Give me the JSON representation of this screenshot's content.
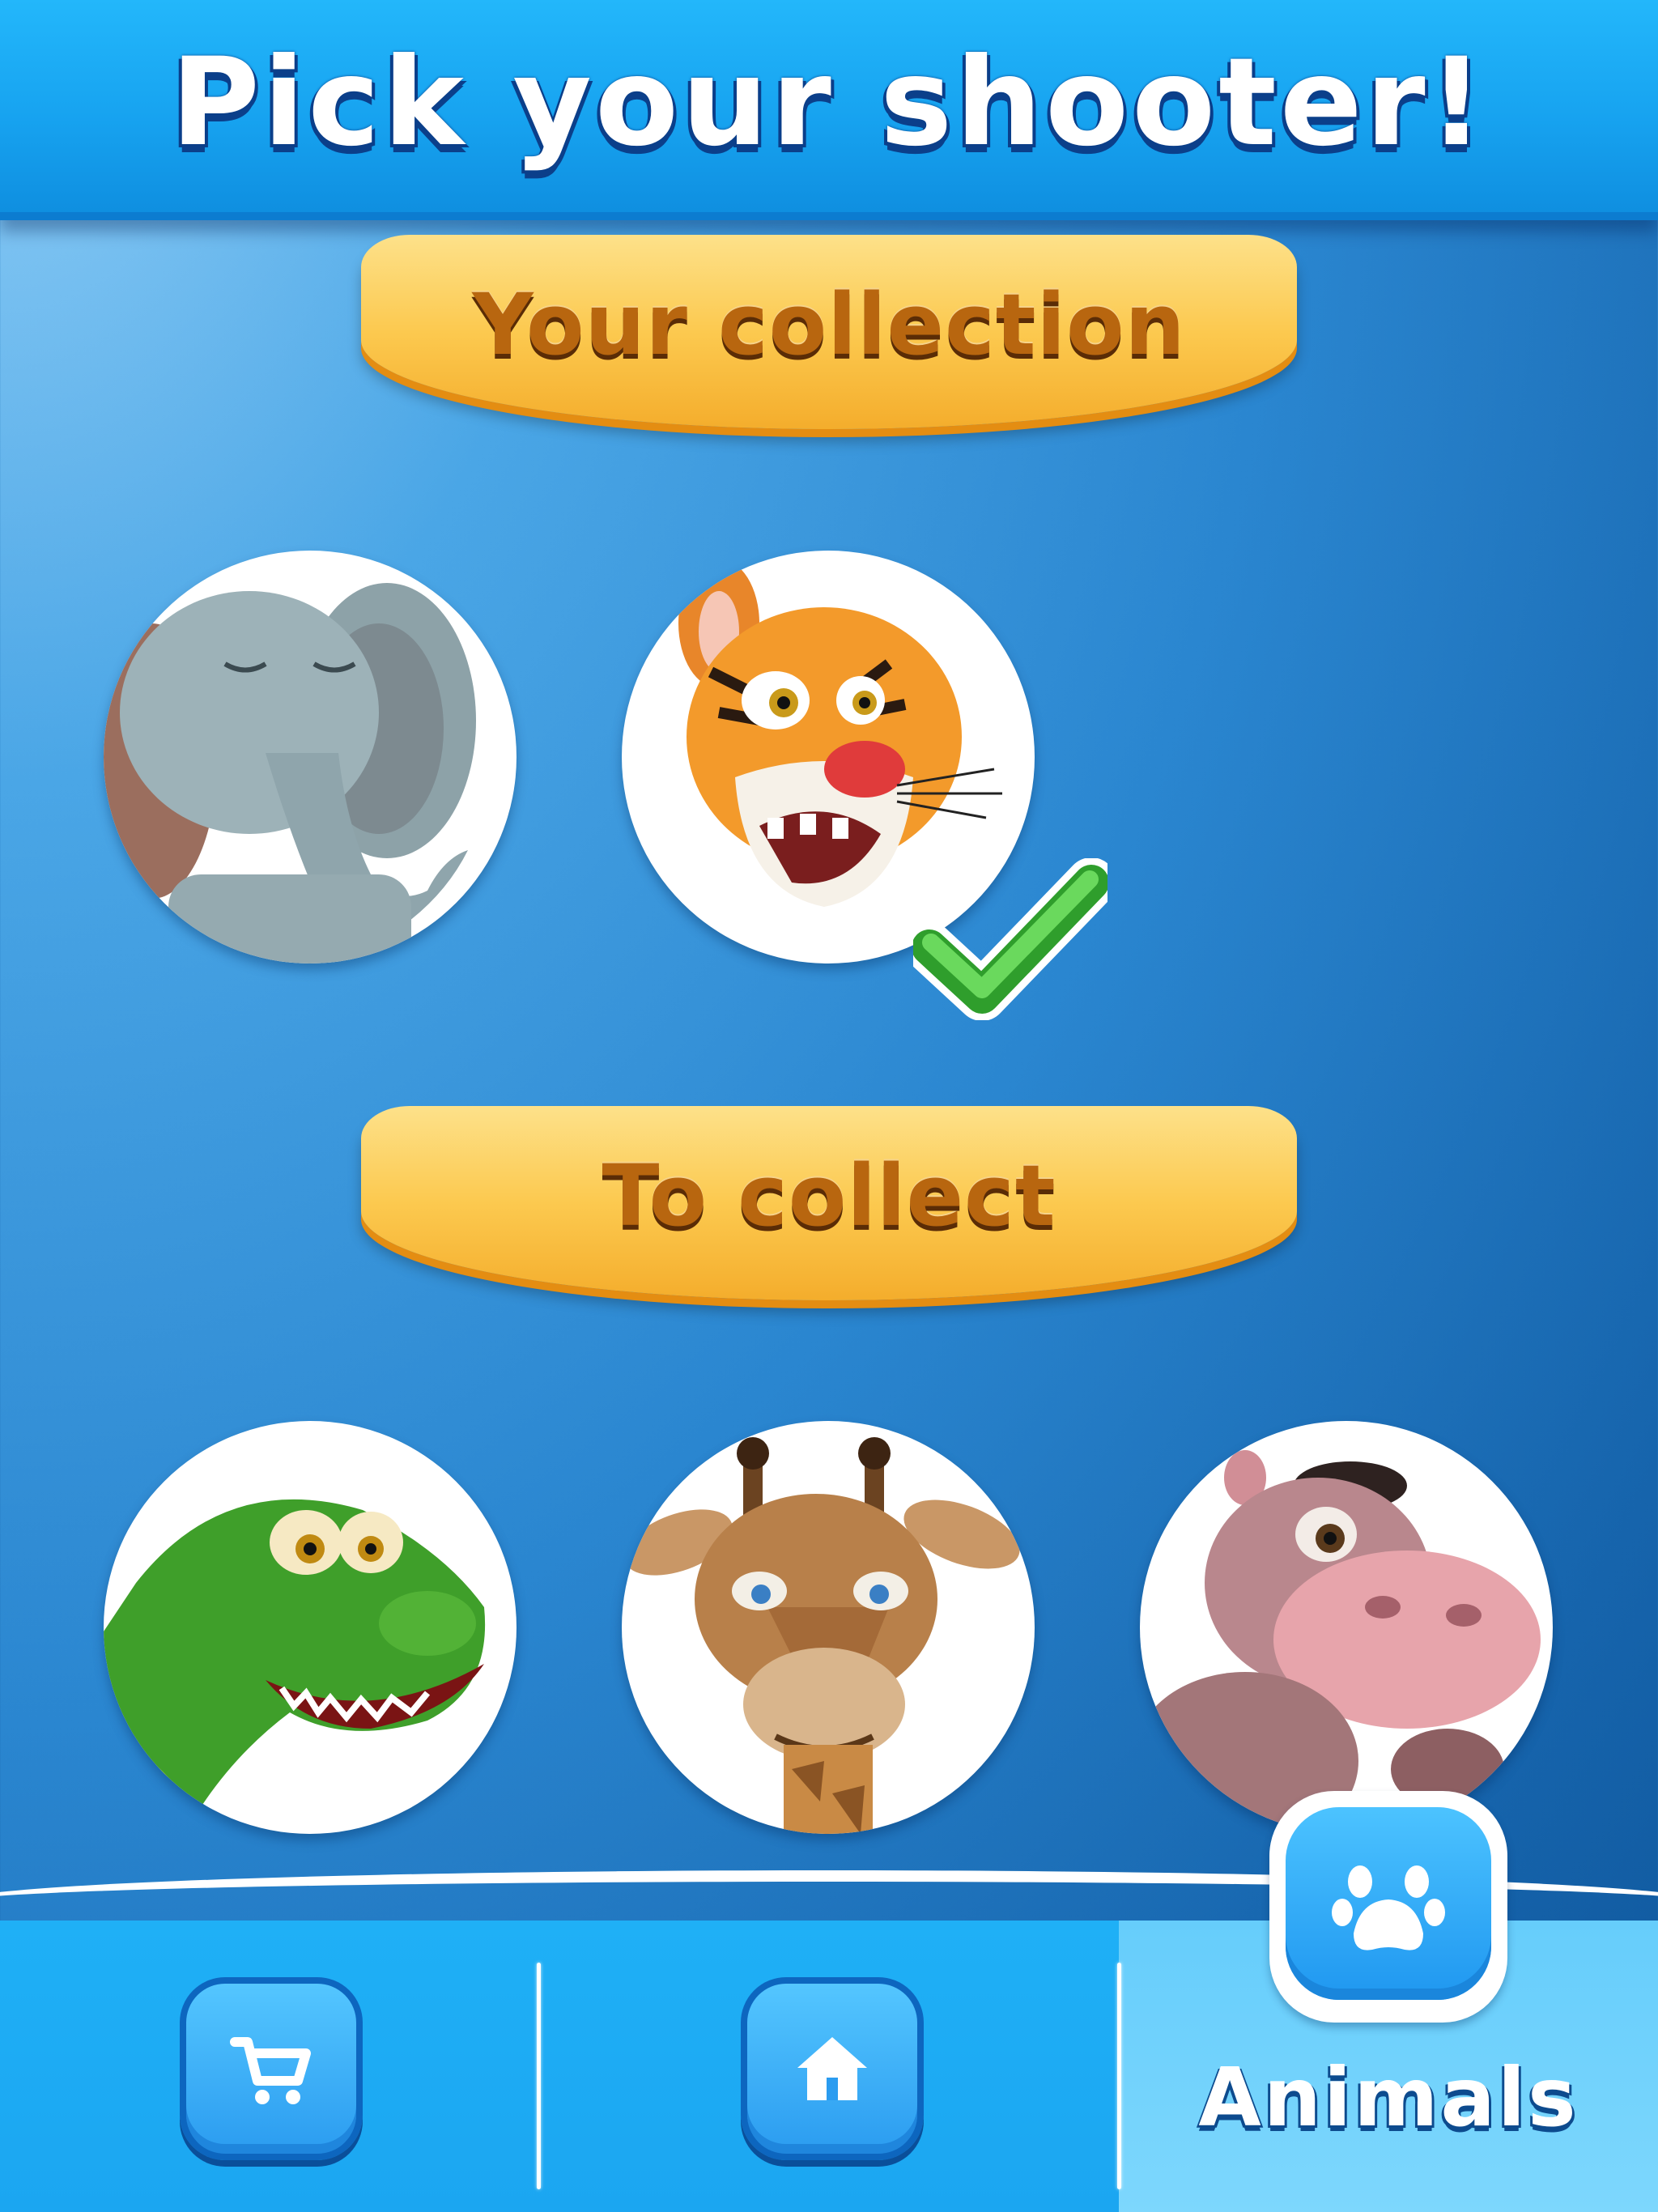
{
  "header": {
    "title": "Pick your shooter!"
  },
  "sections": {
    "collection_label": "Your collection",
    "to_collect_label": "To collect"
  },
  "collection": [
    {
      "animal": "elephant",
      "selected": false
    },
    {
      "animal": "tiger",
      "selected": true
    }
  ],
  "to_collect": [
    {
      "animal": "crocodile"
    },
    {
      "animal": "giraffe"
    },
    {
      "animal": "hippo"
    }
  ],
  "nav": {
    "items": [
      {
        "icon": "cart-icon",
        "active": false
      },
      {
        "icon": "home-icon",
        "active": false
      },
      {
        "icon": "paw-icon",
        "label": "Animals",
        "active": true
      }
    ]
  },
  "colors": {
    "header_blue": "#17a3f0",
    "banner_yellow": "#fcc94f",
    "banner_text": "#b8660f",
    "check_green": "#3fbf3a",
    "nav_blue": "#1ba6f1"
  }
}
